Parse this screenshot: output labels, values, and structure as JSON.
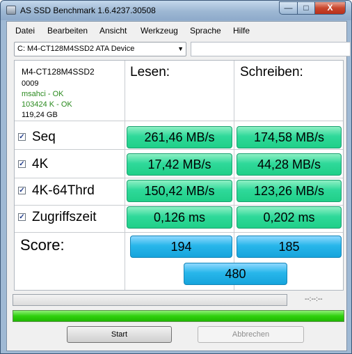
{
  "window": {
    "title": "AS SSD Benchmark 1.6.4237.30508",
    "min_glyph": "—",
    "max_glyph": "□",
    "close_glyph": "X"
  },
  "menu": [
    "Datei",
    "Bearbeiten",
    "Ansicht",
    "Werkzeug",
    "Sprache",
    "Hilfe"
  ],
  "drive": {
    "selected": "C: M4-CT128M4SSD2 ATA Device",
    "arrow": "▼",
    "extra_value": ""
  },
  "info": {
    "model": "M4-CT128M4SSD2",
    "firmware": "0009",
    "driver": "msahci - OK",
    "alignment": "103424 K - OK",
    "size": "119,24 GB"
  },
  "headers": {
    "read": "Lesen:",
    "write": "Schreiben:"
  },
  "rows": [
    {
      "label": "Seq",
      "checked": "✓",
      "read": "261,46 MB/s",
      "write": "174,58 MB/s"
    },
    {
      "label": "4K",
      "checked": "✓",
      "read": "17,42 MB/s",
      "write": "44,28 MB/s"
    },
    {
      "label": "4K-64Thrd",
      "checked": "✓",
      "read": "150,42 MB/s",
      "write": "123,26 MB/s"
    },
    {
      "label": "Zugriffszeit",
      "checked": "✓",
      "read": "0,126 ms",
      "write": "0,202 ms"
    }
  ],
  "score": {
    "label": "Score:",
    "read": "194",
    "write": "185",
    "total": "480"
  },
  "status": {
    "timer": "--:--:--",
    "progress_top": 0,
    "progress_bottom": 1
  },
  "buttons": {
    "start": "Start",
    "abort": "Abbrechen"
  },
  "colors": {
    "value_green": "#2fd99a",
    "score_blue": "#27b6ea",
    "progress_green": "#2fd00e",
    "ok_text": "#2a8a1e"
  }
}
